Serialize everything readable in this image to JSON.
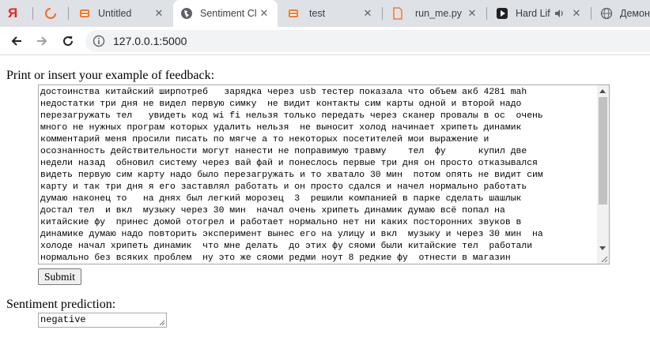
{
  "browser": {
    "tabs": [
      {
        "title": "Я",
        "icon": "yandex-icon"
      },
      {
        "title": "",
        "icon": "loading-spinner-icon"
      },
      {
        "title": "Untitled",
        "icon": "stack-icon"
      },
      {
        "title": "Sentiment Cl",
        "icon": "globe-icon",
        "active": true
      },
      {
        "title": "test",
        "icon": "stack-icon"
      },
      {
        "title": "run_me.py",
        "icon": "file-icon"
      },
      {
        "title": "Hard Lif",
        "icon": "play-icon",
        "audio": true
      },
      {
        "title": "Демон",
        "icon": "globe-icon"
      }
    ],
    "close_glyph": "✕",
    "url": "127.0.0.1:5000"
  },
  "form": {
    "feedback_label": "Print or insert your example of feedback:",
    "feedback_text": "достоинства китайский ширпотреб   зарядка через usb тестер показала что объем акб 4281 mah\nнедостатки три дня не видел первую симку  не видит контакты сим карты одной и второй надо\nперезагружать тел   увидеть код wi fi нельзя только передать через сканер провалы в ос  очень\nмного не нужных програм которых удалить нельзя  не выносит холод начинает хрипеть динамик\nкомментарий меня просили писать по мягче а то некоторых посетителей мои выражение и\nосознанность действительности могут нанести не поправимую травму    тел  фу      купил две\nнедели назад  обновил систему через вай фай и понеслось первые три дня он просто отказывался\nвидеть первую сим карту надо было перезагружать и то хватало 30 мин  потом опять не видит сим\nкарту и так три дня я его заставлял работать и он просто сдался и начел нормально работать\nдумаю наконец то   на днях был легкий морозец  3  решили компанией в парке сделать шашлык\nдостал тел  и вкл  музыку через 30 мин  начал очень хрипеть динамик думаю всё попал на\nкитайские фу  принес домой отогрел и работает нормально нет ни каких посторонних звуков в\nдинамике думаю надо повторить эксперимент вынес его на улицу и вкл  музыку и через 30 мин  на\nхолоде начал хрипеть динамик  что мне делать  до этих фу сяоми были китайские тел  работали\nнормально без всяких проблем  ну это же сяоми редми ноут 8 редкие фу  отнести в магазин",
    "submit_label": "Submit",
    "prediction_label": "Sentiment prediction:",
    "prediction_value": "negative"
  }
}
